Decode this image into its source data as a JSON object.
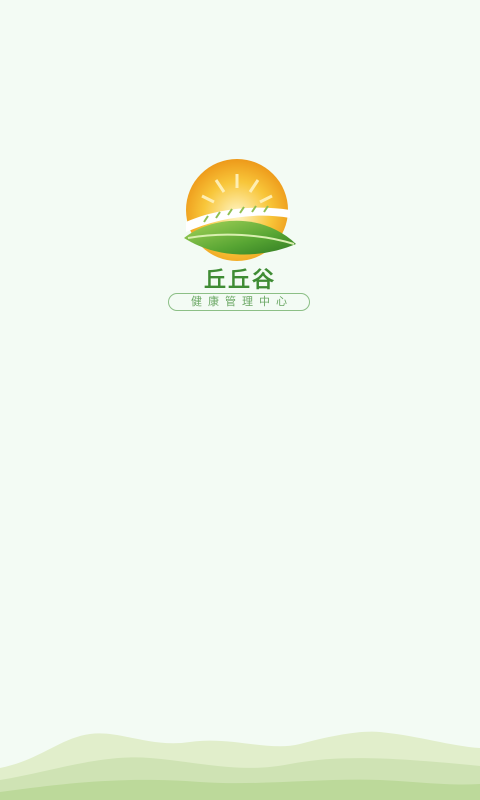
{
  "app": {
    "brand_name": "丘丘谷",
    "tagline": "健康管理中心"
  },
  "colors": {
    "background": "#f3fbf4",
    "brand_green": "#3f8c34",
    "sun_orange": "#f2a51a",
    "leaf_green": "#5aa83a",
    "hill_green": "#cfe3b4"
  },
  "icons": {
    "logo": "sun-over-leaf-logo",
    "footer": "rolling-hills-decoration"
  }
}
